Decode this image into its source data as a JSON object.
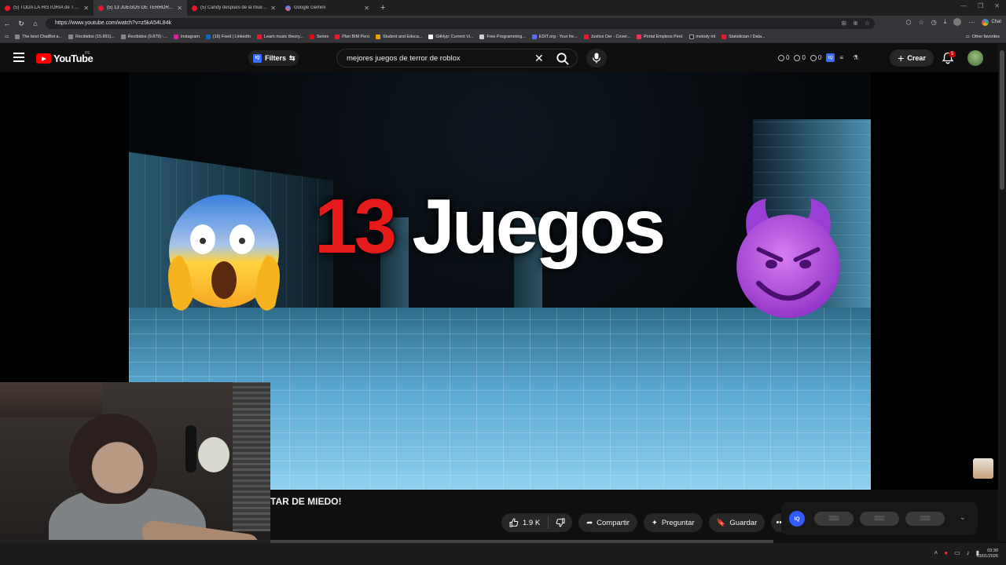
{
  "browser": {
    "tabs": [
      {
        "title": "(5) TODA LA HISTORIA de TRALAL",
        "active": false
      },
      {
        "title": "(5) 13 JUEGOS DE TERROR EN RO",
        "active": true
      },
      {
        "title": "(5) Candy despues de la muerte d",
        "active": false
      },
      {
        "title": "Google Gemini",
        "active": false
      }
    ],
    "url": "https://www.youtube.com/watch?v=z5kA54L84k",
    "chat_label": "Chat",
    "bookmarks": [
      "The best ChatBot a...",
      "Recibidos (15.891)...",
      "Recibidos (9.879) -...",
      "Instagram",
      "(16) Feed | LinkedIn",
      "Learn music theory...",
      "Series",
      "Plan BIM Perú",
      "Student and Educa...",
      "GitHyp: Current Vi...",
      "Free Programming...",
      "EDIT.org - Your fre...",
      "Justice Der - Cover...",
      "Portal Empleos Perú",
      "melody ml",
      "Statistician / Data..."
    ],
    "other_favorites": "Other favorites"
  },
  "youtube": {
    "logo_text": "YouTube",
    "region": "PE",
    "filters_label": "Filters",
    "iq_label": "IQ",
    "search_query": "mejores juegos de terror de roblox",
    "ext_counts": [
      "0",
      "0",
      "0"
    ],
    "create_label": "Crear",
    "notifications_count": "5"
  },
  "video": {
    "thumb_number": "13",
    "thumb_word": "Juegos",
    "title_partial": "TAR DE MIEDO!"
  },
  "actions": {
    "likes": "1.9 K",
    "share": "Compartir",
    "ask": "Preguntar",
    "save": "Guardar"
  },
  "side_panel": {
    "pills": [
      "▒▒▒",
      "▒▒▒",
      "▒▒▒"
    ]
  },
  "taskbar": {
    "time": "03:30",
    "date": "13/01/2026"
  },
  "colors": {
    "youtube_red": "#ff0000",
    "thumb_number_red": "#e51a1a",
    "iq_blue": "#2f5bff"
  }
}
